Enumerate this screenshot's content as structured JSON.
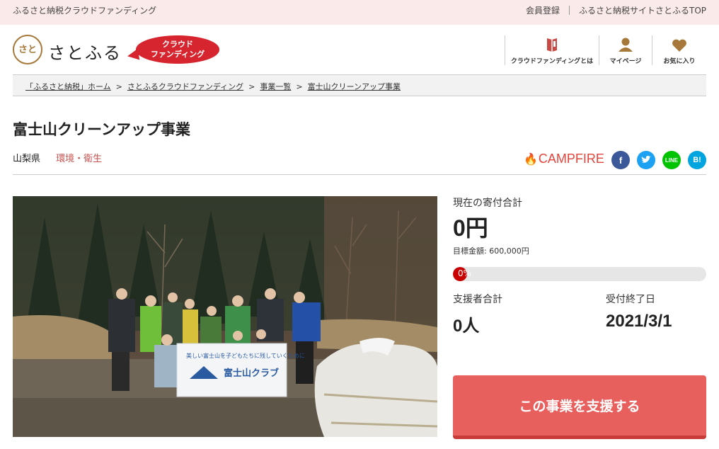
{
  "topbar": {
    "tagline": "ふるさと納税クラウドファンディング",
    "links": [
      "会員登録",
      "ふるさと納税サイトさとふるTOP"
    ]
  },
  "header": {
    "logo_mark": "さと",
    "logo_text": "さとふる",
    "badge_line1": "クラウド",
    "badge_line2": "ファンディング",
    "nav": {
      "about": "クラウドファンディングとは",
      "mypage": "マイページ",
      "favorites": "お気に入り"
    },
    "icons": {
      "about": "book-icon",
      "mypage": "user-icon",
      "favorites": "heart-icon"
    }
  },
  "breadcrumb": [
    "「ふるさと納税」ホーム",
    "さとふるクラウドファンディング",
    "事業一覧",
    "富士山クリーンアップ事業"
  ],
  "project": {
    "title": "富士山クリーンアップ事業",
    "prefecture": "山梨県",
    "category": "環境・衛生",
    "banner_text": "美しい富士山を子どもたちに残していくために",
    "banner_org": "富士山クラブ"
  },
  "share": {
    "campfire": "CAMPFIRE",
    "facebook": "f",
    "twitter": "t",
    "line": "LINE",
    "hatena": "B!"
  },
  "stats": {
    "total_label": "現在の寄付合計",
    "total_value": "0円",
    "goal_text": "目標金額: 600,000円",
    "progress_pct_text": "0%",
    "progress_fraction": 0,
    "supporters_label": "支援者合計",
    "supporters_value": "0人",
    "deadline_label": "受付終了日",
    "deadline_value": "2021/3/1"
  },
  "cta": {
    "label": "この事業を支援する"
  },
  "colors": {
    "accent": "#e8605e",
    "brand_red": "#d6252e",
    "brand_brown": "#a6783a",
    "category": "#c7504e"
  }
}
